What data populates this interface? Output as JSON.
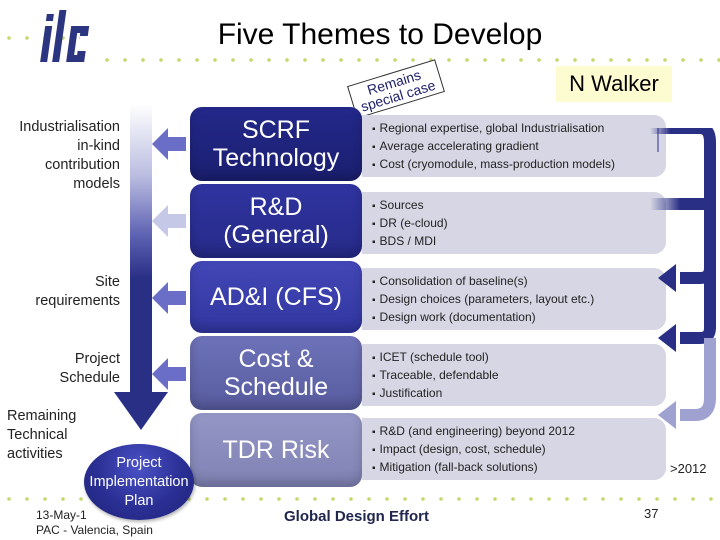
{
  "header": {
    "logo_text": "ilc",
    "title": "Five Themes to Develop",
    "author": "N Walker"
  },
  "callout_note": {
    "line1": "Remains",
    "line2": "special case"
  },
  "left_labels": [
    {
      "text": "Industrialisation in-kind contribution models",
      "lines": [
        "Industrialisation",
        "in-kind",
        "contribution",
        "models"
      ]
    },
    {
      "text": "Site requirements",
      "lines": [
        "Site",
        "requirements"
      ]
    },
    {
      "text": "Project Schedule",
      "lines": [
        "Project",
        "Schedule"
      ]
    },
    {
      "text": "Remaining Technical activities",
      "lines": [
        "Remaining",
        "Technical",
        "activities"
      ]
    }
  ],
  "themes": [
    {
      "title_lines": [
        "SCRF",
        "Technology"
      ],
      "color": "#1f237e",
      "bullets": [
        "Regional expertise, global Industrialisation",
        "Average accelerating gradient",
        "Cost (cryomodule, mass-production models)"
      ]
    },
    {
      "title_lines": [
        "R&D",
        "(General)"
      ],
      "color": "#2b2f95",
      "bullets": [
        "Sources",
        "DR (e-cloud)",
        "BDS / MDI"
      ]
    },
    {
      "title_lines": [
        "AD&I (CFS)"
      ],
      "color": "#3a3fae",
      "bullets": [
        "Consolidation of baseline(s)",
        "Design choices (parameters, layout etc.)",
        "Design work (documentation)"
      ]
    },
    {
      "title_lines": [
        "Cost &",
        "Schedule"
      ],
      "color": "#5f63a8",
      "bullets": [
        "ICET (schedule tool)",
        "Traceable, defendable",
        "Justification"
      ]
    },
    {
      "title_lines": [
        "TDR Risk"
      ],
      "color": "#8a8cbd",
      "bullets": [
        "R&D (and engineering) beyond 2012",
        "Impact (design, cost, schedule)",
        "Mitigation (fall-back solutions)"
      ]
    }
  ],
  "arrow_colors": {
    "dark": "#2a2f86",
    "medium": "#6a6ec6",
    "light": "#c6c8e8",
    "faded": "#9fa2d0"
  },
  "result": {
    "lines": [
      "Project",
      "Implementation",
      "Plan"
    ]
  },
  "annotation_beyond": ">2012",
  "footer": {
    "date_partial": "13-May-1",
    "venue": "PAC - Valencia, Spain",
    "center": "Global Design Effort",
    "page_number": "37"
  }
}
